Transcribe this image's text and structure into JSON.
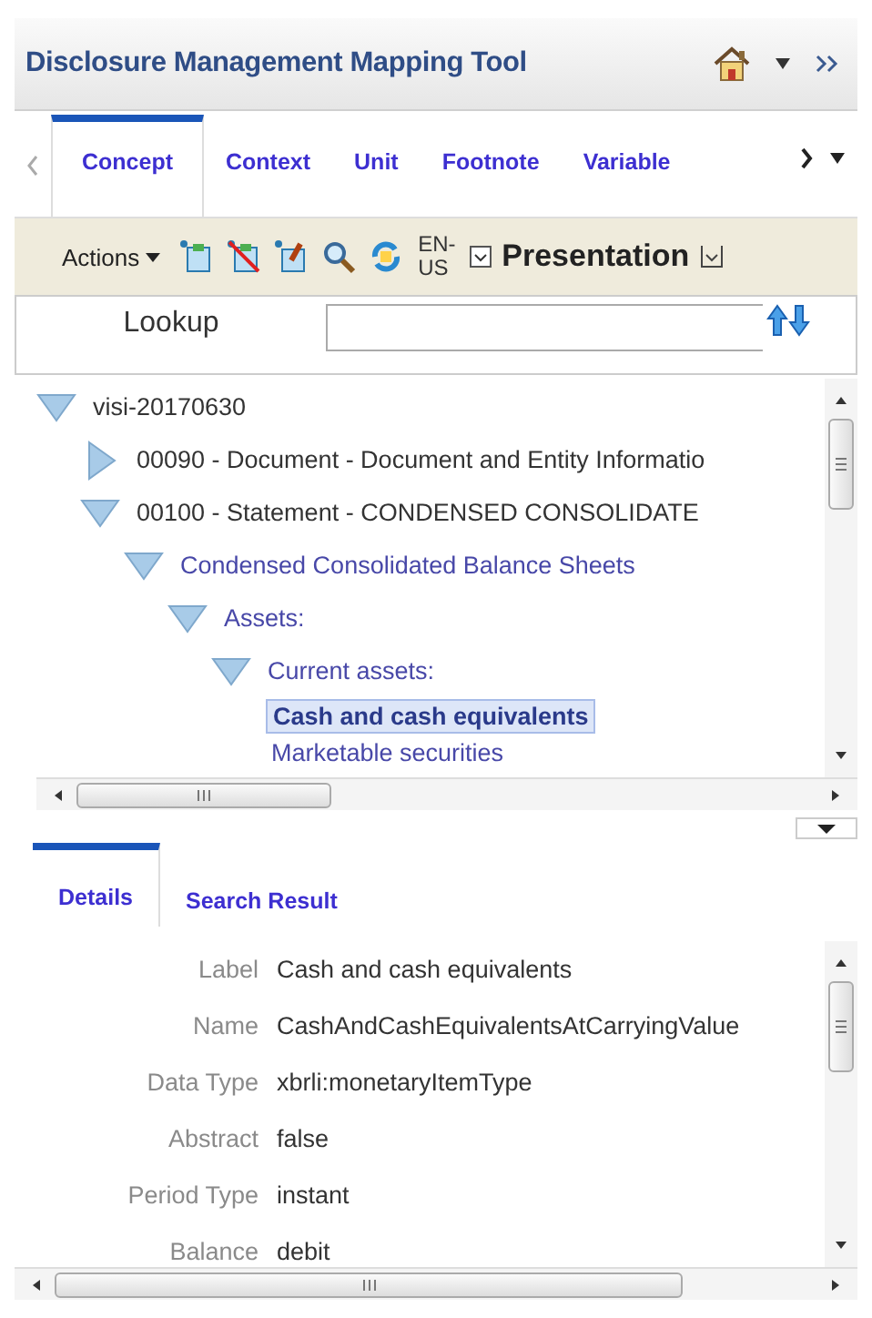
{
  "header": {
    "title": "Disclosure Management Mapping Tool"
  },
  "tabs": [
    {
      "label": "Concept",
      "selected": true
    },
    {
      "label": "Context",
      "selected": false
    },
    {
      "label": "Unit",
      "selected": false
    },
    {
      "label": "Footnote",
      "selected": false
    },
    {
      "label": "Variable",
      "selected": false
    }
  ],
  "toolbar": {
    "actions": "Actions",
    "language": "EN-US",
    "view": "Presentation"
  },
  "lookup": {
    "label": "Lookup"
  },
  "tree": [
    {
      "label": "visi-20170630",
      "expanded": true,
      "selected": false,
      "children": [
        {
          "label": "00090 - Document - Document and Entity Informatio",
          "expanded": false,
          "selected": false
        },
        {
          "label": "00100 - Statement - CONDENSED CONSOLIDATE",
          "expanded": true,
          "selected": false,
          "children": [
            {
              "label": "Condensed Consolidated Balance Sheets",
              "expanded": true,
              "selected": false,
              "children": [
                {
                  "label": "Assets:",
                  "expanded": true,
                  "selected": false,
                  "children": [
                    {
                      "label": "Current assets:",
                      "expanded": true,
                      "selected": false,
                      "children": [
                        {
                          "label": "Cash and cash equivalents",
                          "selected": true
                        },
                        {
                          "label": "Marketable securities",
                          "selected": false
                        }
                      ]
                    }
                  ]
                }
              ]
            }
          ]
        }
      ]
    }
  ],
  "detail_tabs": [
    {
      "label": "Details",
      "selected": true
    },
    {
      "label": "Search Result",
      "selected": false
    }
  ],
  "details": [
    {
      "label": "Label",
      "value": "Cash and cash equivalents"
    },
    {
      "label": "Name",
      "value": "CashAndCashEquivalentsAtCarryingValue"
    },
    {
      "label": "Data Type",
      "value": "xbrli:monetaryItemType"
    },
    {
      "label": "Abstract",
      "value": "false"
    },
    {
      "label": "Period Type",
      "value": "instant"
    },
    {
      "label": "Balance",
      "value": "debit"
    }
  ]
}
